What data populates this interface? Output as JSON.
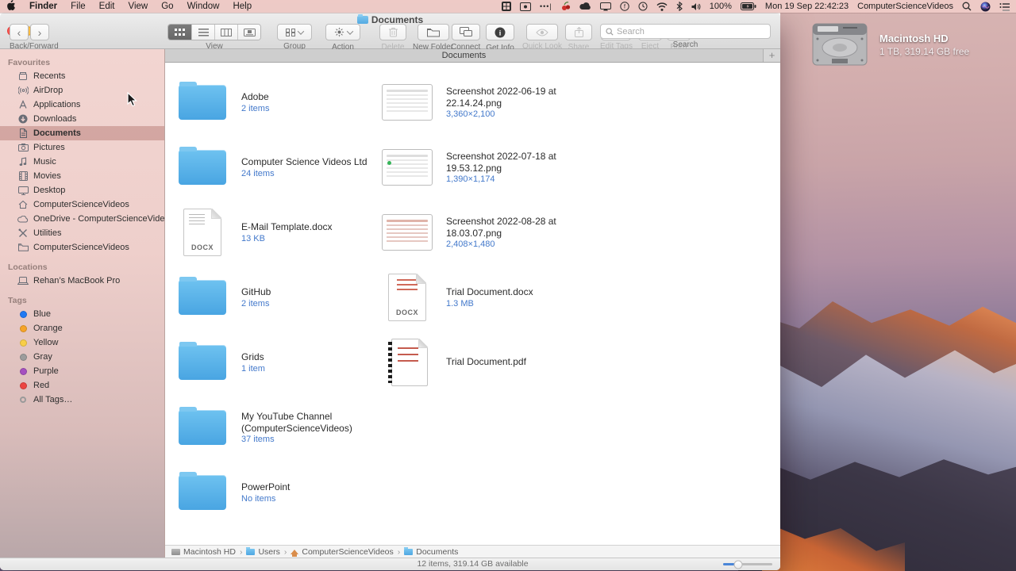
{
  "menu_bar": {
    "menus": [
      "Finder",
      "File",
      "Edit",
      "View",
      "Go",
      "Window",
      "Help"
    ],
    "status": {
      "battery_percent": "100%",
      "datetime": "Mon 19 Sep 22:42:23",
      "user": "ComputerScienceVideos"
    }
  },
  "window": {
    "title": "Documents",
    "tab": {
      "title": "Documents",
      "new_tab": "+"
    },
    "toolbar": {
      "back_forward_label": "Back/Forward",
      "view_label": "View",
      "group_label": "Group",
      "action_label": "Action",
      "delete_label": "Delete",
      "new_folder_label": "New Folder",
      "connect_label": "Connect",
      "get_info_label": "Get Info",
      "quick_look_label": "Quick Look",
      "share_label": "Share",
      "edit_tags_label": "Edit Tags",
      "eject_label": "Eject",
      "burn_label": "Burn",
      "search_label": "Search",
      "search_placeholder": "Search"
    }
  },
  "sidebar": {
    "favourites": {
      "label": "Favourites",
      "items": [
        {
          "label": "Recents",
          "icon": "recents-icon"
        },
        {
          "label": "AirDrop",
          "icon": "airdrop-icon"
        },
        {
          "label": "Applications",
          "icon": "applications-icon"
        },
        {
          "label": "Downloads",
          "icon": "downloads-icon"
        },
        {
          "label": "Documents",
          "icon": "documents-icon"
        },
        {
          "label": "Pictures",
          "icon": "pictures-icon"
        },
        {
          "label": "Music",
          "icon": "music-icon"
        },
        {
          "label": "Movies",
          "icon": "movies-icon"
        },
        {
          "label": "Desktop",
          "icon": "desktop-icon"
        },
        {
          "label": "ComputerScienceVideos",
          "icon": "home-icon"
        },
        {
          "label": "OneDrive - ComputerScienceVideos",
          "icon": "cloud-icon"
        },
        {
          "label": "Utilities",
          "icon": "utilities-icon"
        },
        {
          "label": "ComputerScienceVideos",
          "icon": "folder-icon"
        }
      ]
    },
    "locations": {
      "label": "Locations",
      "items": [
        {
          "label": "Rehan’s MacBook Pro",
          "icon": "laptop-icon"
        }
      ]
    },
    "tags": {
      "label": "Tags",
      "items": [
        {
          "label": "Blue",
          "color": "#2079f4"
        },
        {
          "label": "Orange",
          "color": "#f6a428"
        },
        {
          "label": "Yellow",
          "color": "#f8ce47"
        },
        {
          "label": "Gray",
          "color": "#9c9c9c"
        },
        {
          "label": "Purple",
          "color": "#a550c0"
        },
        {
          "label": "Red",
          "color": "#ec4541"
        },
        {
          "label": "All Tags…",
          "color": "ring"
        }
      ]
    }
  },
  "files": {
    "col1": [
      {
        "name": "Adobe",
        "info": "2 items",
        "type": "folder"
      },
      {
        "name": "Computer Science Videos Ltd",
        "info": "24 items",
        "type": "folder"
      },
      {
        "name": "E-Mail Template.docx",
        "info": "13 KB",
        "type": "docx",
        "badge": "DOCX"
      },
      {
        "name": "GitHub",
        "info": "2 items",
        "type": "folder"
      },
      {
        "name": "Grids",
        "info": "1 item",
        "type": "folder"
      },
      {
        "name": "My YouTube Channel (ComputerScienceVideos)",
        "info": "37 items",
        "type": "folder"
      },
      {
        "name": "PowerPoint",
        "info": "No items",
        "type": "folder"
      }
    ],
    "col2": [
      {
        "name": "Screenshot 2022-06-19 at 22.14.24.png",
        "info": "3,360×2,100",
        "type": "image"
      },
      {
        "name": "Screenshot 2022-07-18 at 19.53.12.png",
        "info": "1,390×1,174",
        "type": "image"
      },
      {
        "name": "Screenshot 2022-08-28 at 18.03.07.png",
        "info": "2,408×1,480",
        "type": "image"
      },
      {
        "name": "Trial Document.docx",
        "info": "1.3 MB",
        "type": "docx",
        "badge": "DOCX"
      },
      {
        "name": "Trial Document.pdf",
        "info": "",
        "type": "pdf"
      }
    ]
  },
  "path_bar": {
    "separator": "›",
    "segments": [
      "Macintosh HD",
      "Users",
      "ComputerScienceVideos",
      "Documents"
    ]
  },
  "status_bar": {
    "text": "12 items, 319.14 GB available"
  },
  "desktop": {
    "drive_name": "Macintosh HD",
    "drive_info": "1 TB, 319.14 GB free"
  },
  "colors": {
    "menu_bar_pink": "#eecbc7",
    "sidebar_pink": "#f0d3cf",
    "selection_pink": "#d5a49f",
    "folder_blue": "#5db7ec",
    "info_blue": "#4379cb",
    "toolbar_grey": "#e3e3e3"
  }
}
